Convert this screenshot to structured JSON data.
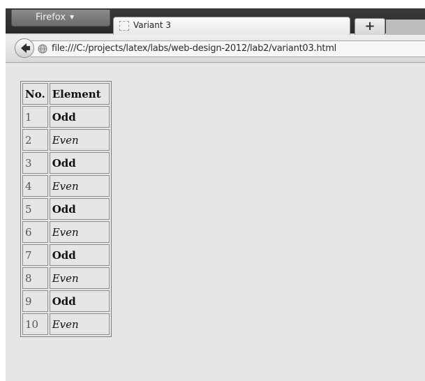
{
  "browser": {
    "app_button_label": "Firefox",
    "tab_title": "Variant 3",
    "new_tab_label": "+",
    "url": "file:///C:/projects/latex/labs/web-design-2012/lab2/variant03.html"
  },
  "table": {
    "headers": [
      "No.",
      "Element"
    ],
    "rows": [
      {
        "no": "1",
        "element": "Odd",
        "style": "odd"
      },
      {
        "no": "2",
        "element": "Even",
        "style": "even"
      },
      {
        "no": "3",
        "element": "Odd",
        "style": "odd"
      },
      {
        "no": "4",
        "element": "Even",
        "style": "even"
      },
      {
        "no": "5",
        "element": "Odd",
        "style": "odd"
      },
      {
        "no": "6",
        "element": "Even",
        "style": "even"
      },
      {
        "no": "7",
        "element": "Odd",
        "style": "odd"
      },
      {
        "no": "8",
        "element": "Even",
        "style": "even"
      },
      {
        "no": "9",
        "element": "Odd",
        "style": "odd"
      },
      {
        "no": "10",
        "element": "Even",
        "style": "even"
      }
    ]
  },
  "icons": {
    "app_caret": "chevron-down-icon",
    "tab_favicon": "page-icon",
    "back": "back-arrow-icon",
    "site_identity": "globe-icon"
  }
}
